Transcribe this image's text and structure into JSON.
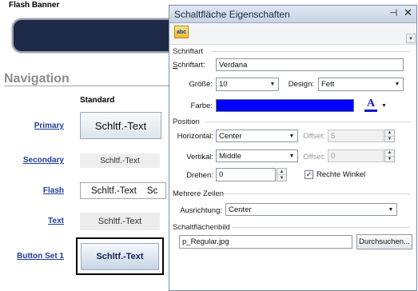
{
  "page": {
    "banner_title": "Flash Banner",
    "nav_title": "Navigation",
    "standard_label": "Standard",
    "colors": {
      "banner_fill": "#1d2a47",
      "link": "#1f3d99",
      "nav_title": "#8c8c8c"
    }
  },
  "nav_rows": [
    {
      "link": "Primary",
      "button": "Schltf.-Text"
    },
    {
      "link": "Secondary",
      "button": "Schltf.-Text"
    },
    {
      "link": "Flash",
      "button": "Schltf.-Text",
      "button_extra": "Sc"
    },
    {
      "link": "Text",
      "button": "Schltf.-Text"
    },
    {
      "link": "Button Set 1",
      "button": "Schltf.-Text"
    }
  ],
  "panel": {
    "title": "Schaltfläche Eigenschaften",
    "pin_icon": "pin-icon",
    "close_icon": "close-icon",
    "toolbar_button": "abc",
    "schriftart": {
      "section": "Schriftart",
      "font_label": "Schriftart:",
      "font_value": "Verdana",
      "size_label": "Größe:",
      "size_value": "10",
      "design_label": "Design:",
      "design_value": "Fett",
      "color_label": "Farbe:",
      "color_value": "#0000ff",
      "text_color_glyph": "A",
      "text_color_bar": "#1515c4"
    },
    "position": {
      "section": "Position",
      "horizontal_label": "Horizontal:",
      "horizontal_value": "Center",
      "offset_label": "Offset:",
      "horizontal_offset": "5",
      "vertical_label": "Vertikal:",
      "vertical_value": "Middle",
      "vertical_offset": "0",
      "rotate_label": "Drehen:",
      "rotate_value": "0",
      "right_angle_label": "Rechte Winkel",
      "right_angle_checked": true
    },
    "multiline": {
      "section": "Mehrere Zeilen",
      "align_label": "Ausrichtung:",
      "align_value": "Center"
    },
    "image": {
      "section": "Schaltflächenbild",
      "file_value": "p_Regular.jpg",
      "browse_label": "Durchsuchen..."
    }
  }
}
